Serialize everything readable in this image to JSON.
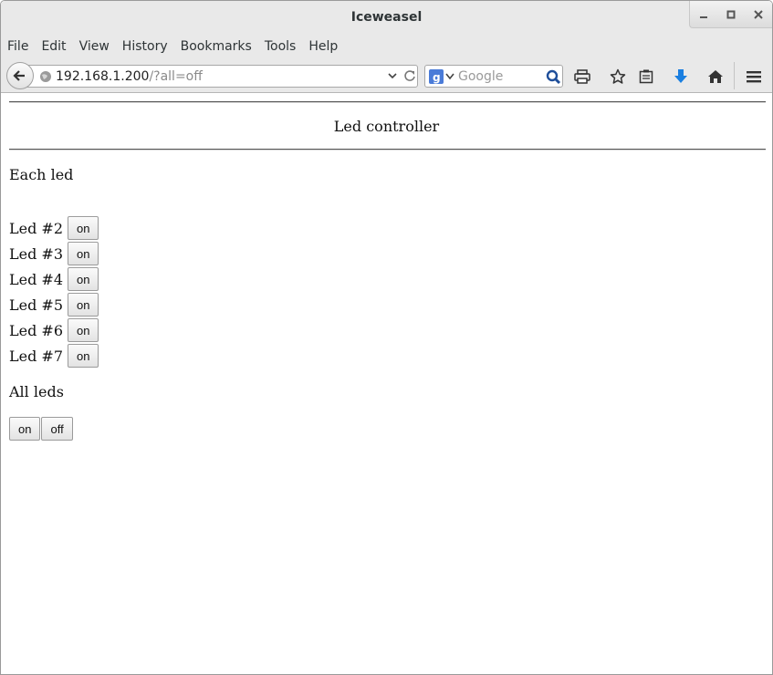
{
  "window": {
    "title": "Iceweasel"
  },
  "menu": [
    "File",
    "Edit",
    "View",
    "History",
    "Bookmarks",
    "Tools",
    "Help"
  ],
  "urlbar": {
    "host": "192.168.1.200",
    "path": "/?all=off"
  },
  "search": {
    "placeholder": "Google",
    "engine": "google-icon"
  },
  "toolbar_icons": [
    "print-icon",
    "bookmark-star-icon",
    "reading-list-icon",
    "download-icon",
    "home-icon",
    "menu-icon"
  ],
  "page": {
    "title": "Led controller",
    "each_label": "Each led",
    "leds": [
      {
        "label": "Led #2",
        "button": "on"
      },
      {
        "label": "Led #3",
        "button": "on"
      },
      {
        "label": "Led #4",
        "button": "on"
      },
      {
        "label": "Led #5",
        "button": "on"
      },
      {
        "label": "Led #6",
        "button": "on"
      },
      {
        "label": "Led #7",
        "button": "on"
      }
    ],
    "all_label": "All leds",
    "all_on": "on",
    "all_off": "off"
  },
  "colors": {
    "download_arrow": "#1a7fe0",
    "google_blue": "#4a7bd8"
  }
}
